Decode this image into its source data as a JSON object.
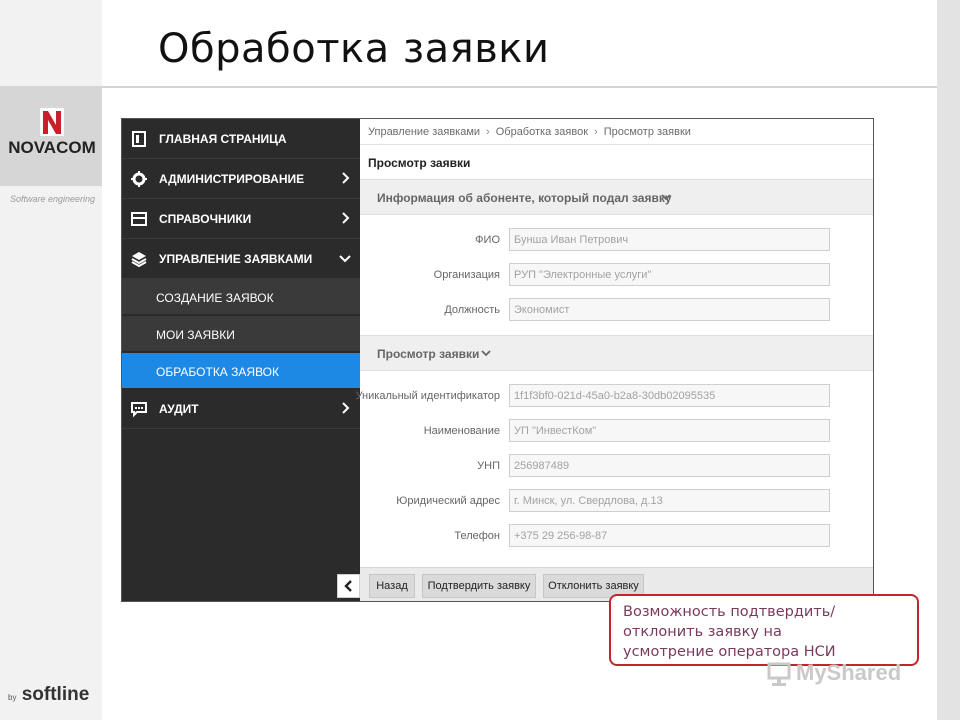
{
  "slide": {
    "title": "Обработка заявки",
    "logo_text": "NOVACOM",
    "tagline": "Software engineering",
    "footer_brand_prefix": "by",
    "footer_brand": "softline",
    "watermark_text": "MyShared"
  },
  "sidebar": {
    "items": [
      {
        "label": "ГЛАВНАЯ СТРАНИЦА",
        "icon": "document-icon"
      },
      {
        "label": "АДМИНИСТРИРОВАНИЕ",
        "icon": "gear-icon"
      },
      {
        "label": "СПРАВОЧНИКИ",
        "icon": "folder-icon"
      },
      {
        "label": "УПРАВЛЕНИЕ ЗАЯВКАМИ",
        "icon": "layers-icon"
      }
    ],
    "subitems": [
      {
        "label": "СОЗДАНИЕ ЗАЯВОК"
      },
      {
        "label": "МОИ ЗАЯВКИ"
      },
      {
        "label": "ОБРАБОТКА ЗАЯВОК",
        "active": true
      }
    ],
    "audit": {
      "label": "АУДИТ",
      "icon": "chat-icon"
    }
  },
  "breadcrumb": [
    "Управление заявками",
    "Обработка заявок",
    "Просмотр заявки"
  ],
  "breadcrumb_sep": "›",
  "page_title": "Просмотр заявки",
  "section1": {
    "title": "Информация об абоненте, который подал заявку",
    "fields": [
      {
        "label": "ФИО",
        "value": "Бунша Иван Петрович"
      },
      {
        "label": "Организация",
        "value": "РУП \"Электронные услуги\""
      },
      {
        "label": "Должность",
        "value": "Экономист"
      }
    ]
  },
  "section2": {
    "title": "Просмотр заявки",
    "fields": [
      {
        "label": "Уникальный идентификатор",
        "value": "1f1f3bf0-021d-45a0-b2a8-30db02095535"
      },
      {
        "label": "Наименование",
        "value": "УП \"ИнвестКом\""
      },
      {
        "label": "УНП",
        "value": "256987489"
      },
      {
        "label": "Юридический адрес",
        "value": "г. Минск, ул. Свердлова, д.13"
      },
      {
        "label": "Телефон",
        "value": "+375 29 256-98-87"
      }
    ]
  },
  "actions": {
    "back": "Назад",
    "confirm": "Подтвердить заявку",
    "reject": "Отклонить заявку"
  },
  "callout": {
    "lines": [
      "Возможность подтвердить/",
      "отклонить заявку на",
      "усмотрение оператора НСИ"
    ]
  },
  "colors": {
    "sidebar_bg": "#2b2b2b",
    "active_item": "#1e88e5",
    "callout_border": "#c0262d",
    "callout_text": "#7a3a5e"
  }
}
